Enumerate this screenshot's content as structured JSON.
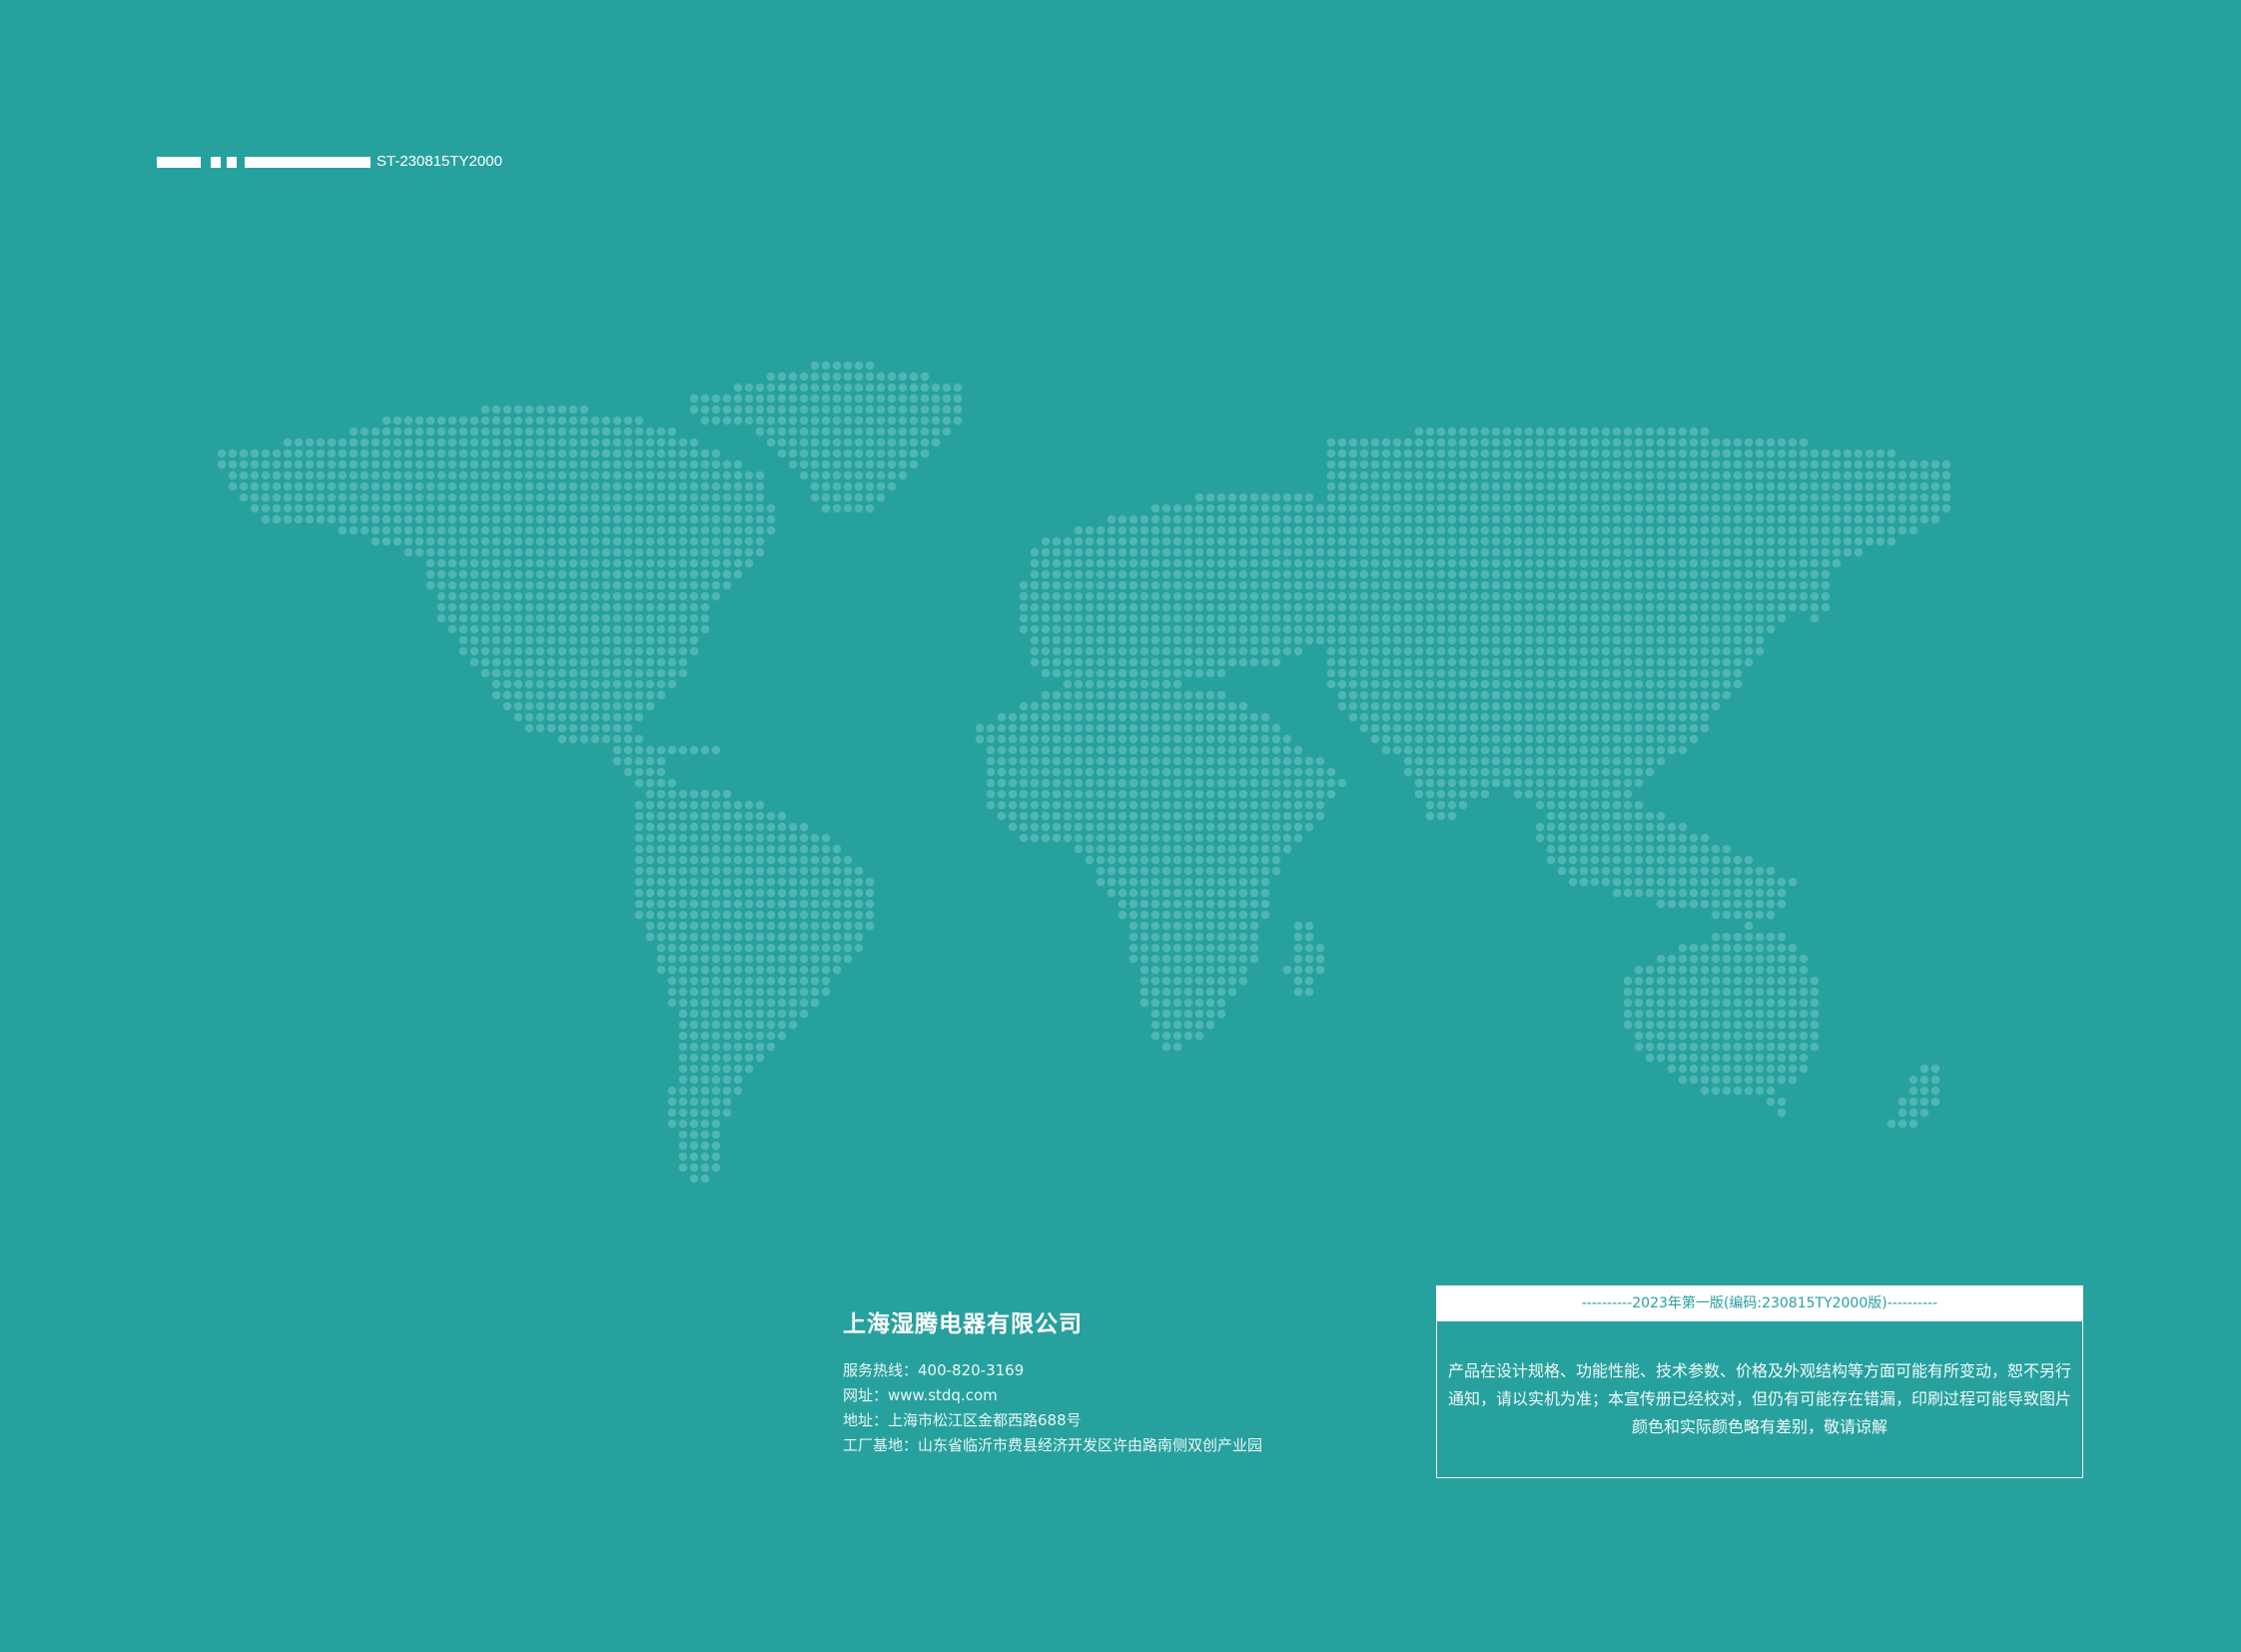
{
  "doc_code": "ST-230815TY2000",
  "company": {
    "name": "上海湿腾电器有限公司",
    "lines": [
      "服务热线：400-820-3169",
      "网址：www.stdq.com",
      "地址：上海市松江区金都西路688号",
      "工厂基地：山东省临沂市费县经济开发区许由路南侧双创产业园"
    ]
  },
  "notice": {
    "edition": "----------2023年第一版(编码:230815TY2000版)----------",
    "body": "产品在设计规格、功能性能、技术参数、价格及外观结构等方面可能有所变动，恕不另行通知，请以实机为准；本宣传册已经校对，但仍有可能存在错漏，印刷过程可能导致图片颜色和实际颜色略有差别，敬请谅解"
  },
  "colors": {
    "background": "#27a19e",
    "dots": "#4fb6b3",
    "text": "#ffffff"
  }
}
